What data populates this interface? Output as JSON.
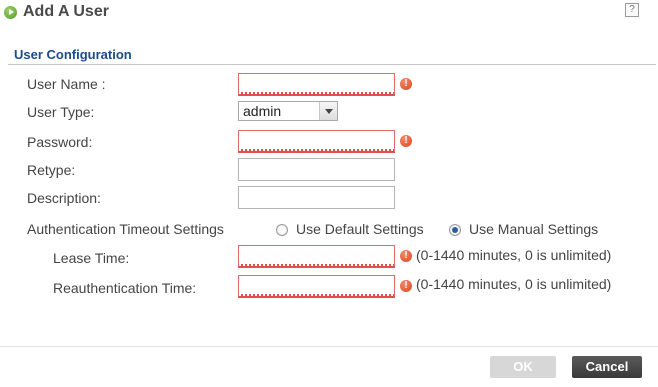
{
  "dialog": {
    "title": "Add A User",
    "help_symbol": "?"
  },
  "section": {
    "title": "User Configuration"
  },
  "form": {
    "user_name_label": "User Name :",
    "user_name_value": "",
    "user_type_label": "User Type:",
    "user_type_value": "admin",
    "password_label": "Password:",
    "password_value": "",
    "retype_label": "Retype:",
    "retype_value": "",
    "description_label": "Description:",
    "description_value": "",
    "error_symbol": "!"
  },
  "auth_timeout": {
    "label": "Authentication Timeout Settings",
    "options": [
      "Use Default Settings",
      "Use Manual Settings"
    ],
    "selected": "Use Manual Settings",
    "lease_time_label": "Lease Time:",
    "lease_time_value": "",
    "lease_time_hint": "(0-1440 minutes, 0 is unlimited)",
    "reauth_time_label": "Reauthentication Time:",
    "reauth_time_value": "",
    "reauth_time_hint": "(0-1440 minutes, 0 is unlimited)"
  },
  "buttons": {
    "ok": "OK",
    "cancel": "Cancel"
  },
  "colors": {
    "section_title": "#1d4a8c",
    "error": "#d9471e",
    "radio_selected": "#2c5fa0"
  }
}
